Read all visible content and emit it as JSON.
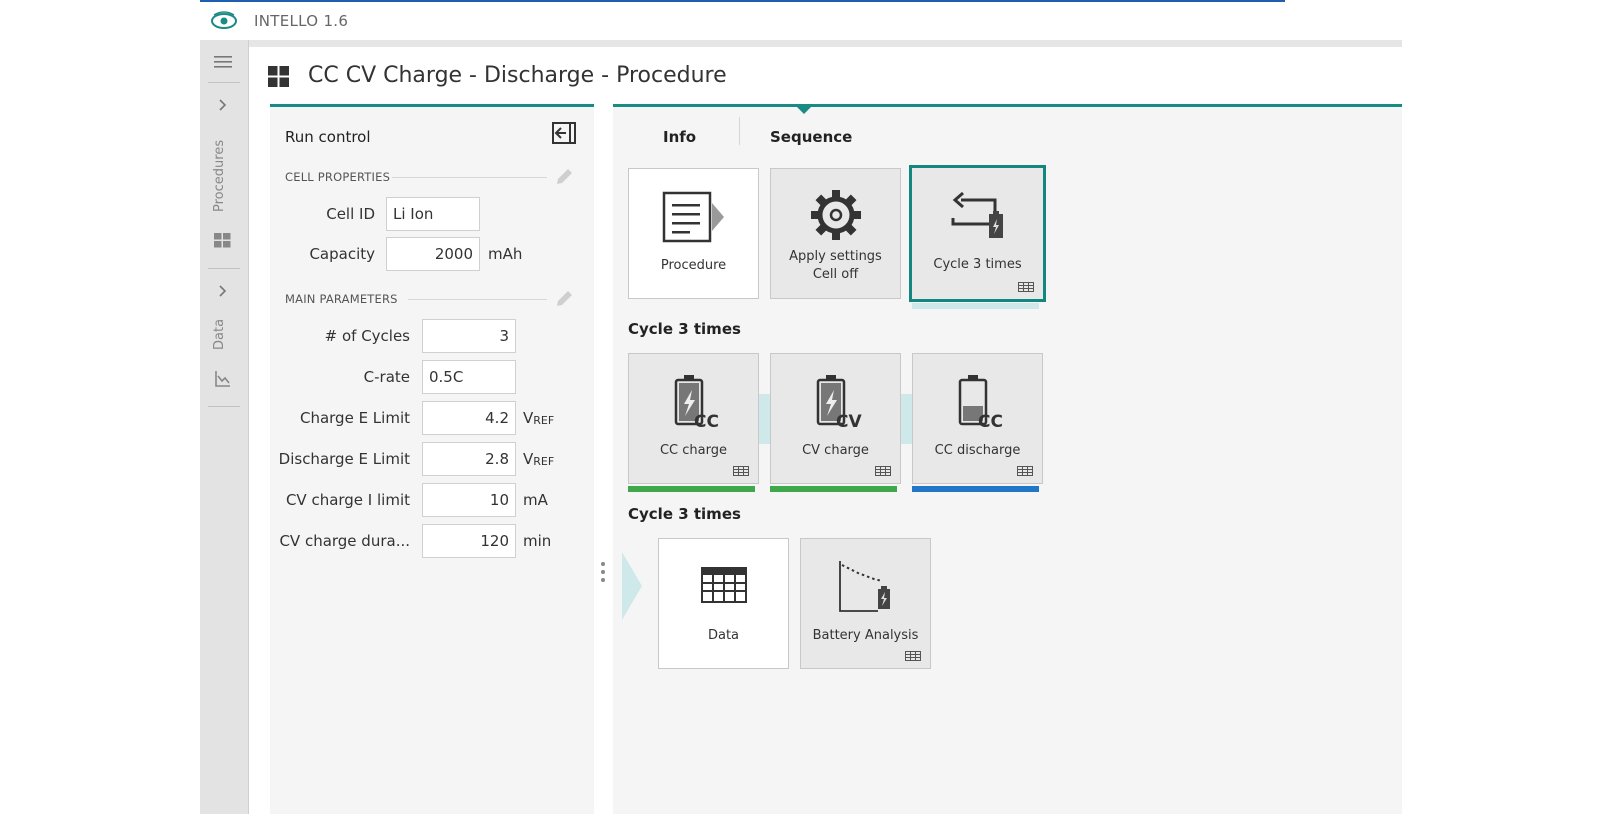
{
  "app": {
    "title": "INTELLO 1.6",
    "logo_icon": "eye-logo-icon",
    "accent": "#1a8a85"
  },
  "rail": {
    "menu_icon": "hamburger-icon",
    "sections": [
      {
        "label": "Procedures",
        "expand_icon": "chevron-right-icon",
        "icon": "grid-icon"
      },
      {
        "label": "Data",
        "expand_icon": "chevron-right-icon",
        "icon": "chart-icon"
      }
    ]
  },
  "page": {
    "title": "CC CV Charge - Discharge  - Procedure",
    "title_icon": "grid-icon"
  },
  "run_control": {
    "title": "Run control",
    "collapse_icon": "collapse-panel-icon",
    "cell_properties": {
      "heading": "CELL PROPERTIES",
      "fields": [
        {
          "label": "Cell ID",
          "value": "Li Ion",
          "unit": ""
        },
        {
          "label": "Capacity",
          "value": "2000",
          "unit": "mAh"
        }
      ]
    },
    "main_parameters": {
      "heading": "MAIN PARAMETERS",
      "fields": [
        {
          "label": "# of Cycles",
          "value": "3",
          "unit": ""
        },
        {
          "label": "C-rate",
          "value": "0.5C",
          "unit": ""
        },
        {
          "label": "Charge E Limit",
          "value": "4.2",
          "unit": "V",
          "unit_sub": "REF"
        },
        {
          "label": "Discharge E Limit",
          "value": "2.8",
          "unit": "V",
          "unit_sub": "REF"
        },
        {
          "label": "CV charge I limit",
          "value": "10",
          "unit": "mA"
        },
        {
          "label": "CV charge dura...",
          "value": "120",
          "unit": "min"
        }
      ]
    }
  },
  "sequence": {
    "tabs": [
      {
        "label": "Info"
      },
      {
        "label": "Sequence",
        "active": true
      }
    ],
    "top_tiles": [
      {
        "label": "Procedure",
        "icon": "procedure-doc-icon"
      },
      {
        "label": "Apply settings",
        "label2": "Cell off",
        "icon": "gear-icon"
      },
      {
        "label": "Cycle 3 times",
        "icon": "cycle-battery-icon",
        "selected": true
      }
    ],
    "group1": {
      "title": "Cycle 3 times",
      "tiles": [
        {
          "label": "CC charge",
          "icon": "battery-cc-charge-icon",
          "bar_color": "#3fa84a"
        },
        {
          "label": "CV charge",
          "icon": "battery-cv-charge-icon",
          "bar_color": "#3fa84a"
        },
        {
          "label": "CC discharge",
          "icon": "battery-cc-discharge-icon",
          "bar_color": "#2176c7"
        }
      ]
    },
    "group2": {
      "title": "Cycle 3 times",
      "tiles": [
        {
          "label": "Data",
          "icon": "data-table-icon"
        },
        {
          "label": "Battery Analysis",
          "icon": "battery-analysis-icon"
        }
      ]
    },
    "badge_icon": "grid-badge-icon"
  }
}
